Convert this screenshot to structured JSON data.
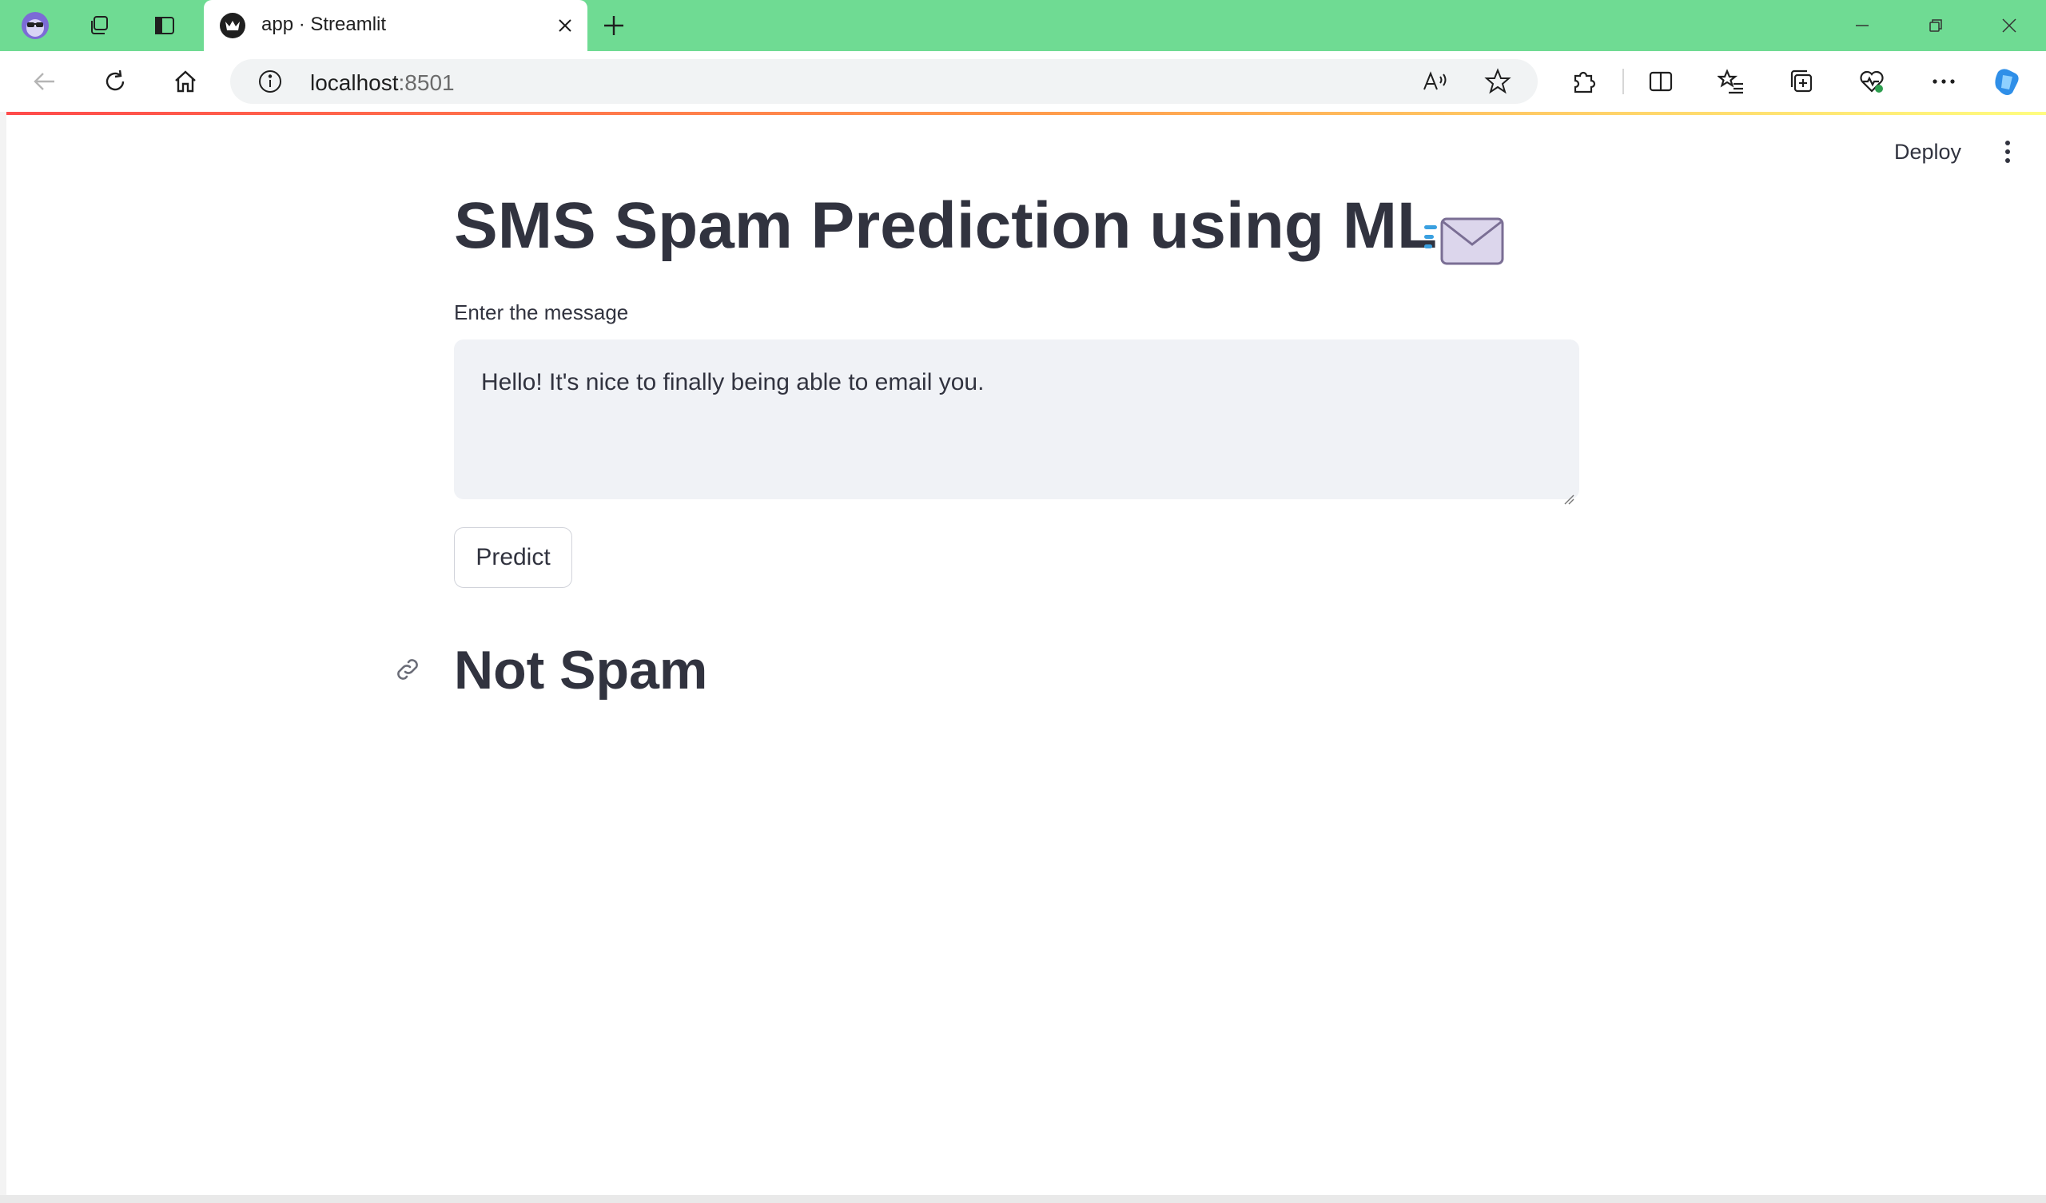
{
  "browser": {
    "tab": {
      "title": "app · Streamlit"
    },
    "address_bar": {
      "host": "localhost",
      "port": ":8501"
    }
  },
  "app": {
    "header": {
      "deploy_label": "Deploy"
    },
    "title": "SMS Spam Prediction using ML",
    "title_emoji": "incoming-envelope",
    "input": {
      "label": "Enter the message",
      "value": "Hello! It's nice to finally being able to email you."
    },
    "predict_button": "Predict",
    "result": "Not Spam"
  },
  "colors": {
    "titlebar": "#6fdb93",
    "text": "#31333f",
    "textarea_bg": "#f0f2f6",
    "decoration_gradient": [
      "#ff4b4b",
      "#fffd80"
    ]
  }
}
